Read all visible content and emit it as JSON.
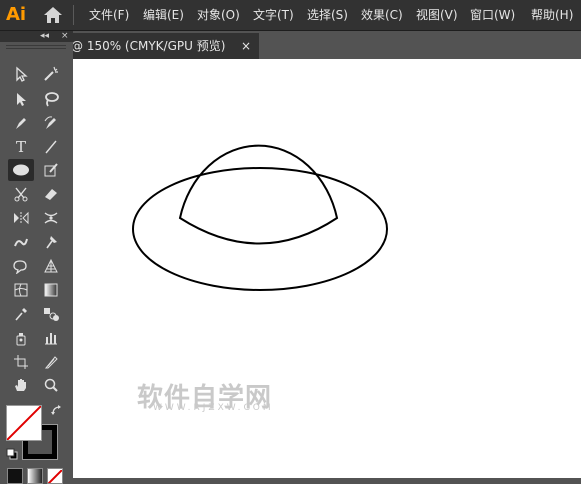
{
  "app": {
    "logo_text": "Ai",
    "logo_color": "#ff9a00"
  },
  "menubar": {
    "items": [
      {
        "label": "文件(F)"
      },
      {
        "label": "编辑(E)"
      },
      {
        "label": "对象(O)"
      },
      {
        "label": "文字(T)"
      },
      {
        "label": "选择(S)"
      },
      {
        "label": "效果(C)"
      },
      {
        "label": "视图(V)"
      },
      {
        "label": "窗口(W)"
      },
      {
        "label": "帮助(H)"
      }
    ]
  },
  "document_tab": {
    "title": "@ 150% (CMYK/GPU 预览)",
    "close_glyph": "×"
  },
  "toolbox": {
    "collapse_glyph": "◂◂",
    "close_glyph": "×",
    "tools": [
      {
        "icon": "selection-tool-icon"
      },
      {
        "icon": "magic-wand-icon"
      },
      {
        "icon": "direct-selection-icon"
      },
      {
        "icon": "lasso-icon"
      },
      {
        "icon": "pen-tool-icon"
      },
      {
        "icon": "curvature-tool-icon"
      },
      {
        "icon": "type-tool-icon",
        "glyph": "T"
      },
      {
        "icon": "line-segment-icon"
      },
      {
        "icon": "ellipse-tool-icon",
        "active": true
      },
      {
        "icon": "paintbrush-icon"
      },
      {
        "icon": "scissors-icon"
      },
      {
        "icon": "eraser-icon"
      },
      {
        "icon": "reflect-tool-icon"
      },
      {
        "icon": "width-tool-icon"
      },
      {
        "icon": "warp-tool-icon"
      },
      {
        "icon": "puppet-warp-icon"
      },
      {
        "icon": "free-transform-icon"
      },
      {
        "icon": "perspective-grid-icon"
      },
      {
        "icon": "mesh-tool-icon"
      },
      {
        "icon": "gradient-tool-icon"
      },
      {
        "icon": "eyedropper-icon"
      },
      {
        "icon": "blend-tool-icon"
      },
      {
        "icon": "symbol-sprayer-icon"
      },
      {
        "icon": "column-graph-icon"
      },
      {
        "icon": "artboard-tool-icon"
      },
      {
        "icon": "slice-tool-icon"
      },
      {
        "icon": "hand-tool-icon"
      },
      {
        "icon": "zoom-tool-icon"
      }
    ],
    "fill_color": "#ffffff",
    "stroke_color": "#000000"
  },
  "watermark": {
    "big_text": "软件自学网",
    "small_text": "WWW.RJZXW.COM"
  }
}
